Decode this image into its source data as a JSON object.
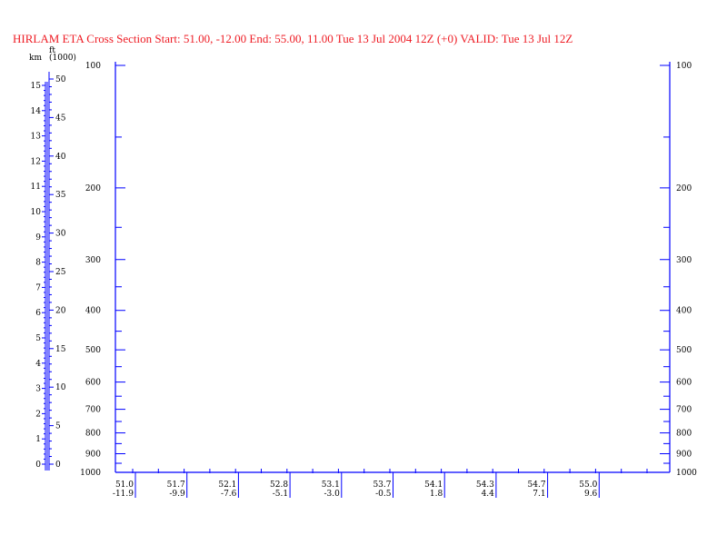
{
  "title": "HIRLAM ETA Cross Section Start:  51.00, -12.00 End:  55.00,  11.00 Tue 13 Jul 2004 12Z  (+0) VALID: Tue 13 Jul 12Z",
  "colors": {
    "title": "#ee1c24",
    "axis": "#0000ff",
    "text": "#000000"
  },
  "chart_data": {
    "type": "line",
    "title": "HIRLAM ETA Cross Section Start:  51.00, -12.00 End:  55.00,  11.00 Tue 13 Jul 2004 12Z  (+0) VALID: Tue 13 Jul 12Z",
    "series": [],
    "pressure_axis": {
      "scale": "log",
      "inverted": true,
      "range": [
        100,
        1000
      ],
      "labels": [
        {
          "value": 100,
          "text": "100"
        },
        {
          "value": 200,
          "text": "200"
        },
        {
          "value": 300,
          "text": "300"
        },
        {
          "value": 400,
          "text": "400"
        },
        {
          "value": 500,
          "text": "500"
        },
        {
          "value": 600,
          "text": "600"
        },
        {
          "value": 700,
          "text": "700"
        },
        {
          "value": 800,
          "text": "800"
        },
        {
          "value": 900,
          "text": "900"
        },
        {
          "value": 1000,
          "text": "1000"
        }
      ],
      "minor_ticks": [
        150,
        250,
        350,
        450,
        550,
        650,
        750,
        850,
        950
      ]
    },
    "height_km_axis": {
      "unit_label": "km",
      "range": [
        0,
        15
      ],
      "labels": [
        "0",
        "1",
        "2",
        "3",
        "4",
        "5",
        "6",
        "7",
        "8",
        "9",
        "10",
        "11",
        "12",
        "13",
        "14",
        "15"
      ]
    },
    "height_ft_axis": {
      "unit_label": "ft",
      "unit_label_2": "(1000)",
      "range": [
        0,
        50
      ],
      "labels": [
        "0",
        "5",
        "10",
        "15",
        "20",
        "25",
        "30",
        "35",
        "40",
        "45",
        "50"
      ]
    },
    "x_axis": {
      "labels": [
        {
          "lat": "51.0",
          "lon": "-11.9"
        },
        {
          "lat": "51.7",
          "lon": "-9.9"
        },
        {
          "lat": "52.1",
          "lon": "-7.6"
        },
        {
          "lat": "52.8",
          "lon": "-5.1"
        },
        {
          "lat": "53.1",
          "lon": "-3.0"
        },
        {
          "lat": "53.7",
          "lon": "-0.5"
        },
        {
          "lat": "54.1",
          "lon": "1.8"
        },
        {
          "lat": "54.3",
          "lon": "4.4"
        },
        {
          "lat": "54.7",
          "lon": "7.1"
        },
        {
          "lat": "55.0",
          "lon": "9.6"
        }
      ]
    }
  }
}
